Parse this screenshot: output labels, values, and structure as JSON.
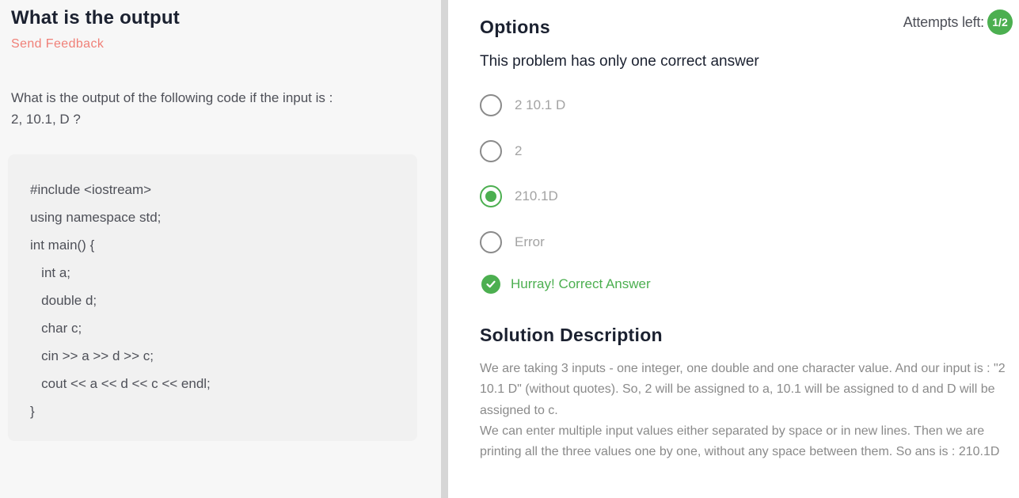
{
  "question": {
    "title": "What is the output",
    "feedback_label": "Send Feedback",
    "text_line1": "What is the output of the following code if the input is :",
    "text_line2": "2, 10.1, D ?",
    "code_lines": [
      "#include <iostream>",
      "using namespace std;",
      "int main() {",
      "   int a;",
      "   double d;",
      "   char c;",
      "   cin >> a >> d >> c;",
      "   cout << a << d << c << endl;",
      "}"
    ]
  },
  "options_panel": {
    "title": "Options",
    "attempts_label": "Attempts left:",
    "attempts_value": "1/2",
    "hint": "This problem has only one correct answer",
    "options": [
      {
        "label": "2 10.1 D",
        "selected": false
      },
      {
        "label": "2",
        "selected": false
      },
      {
        "label": "210.1D",
        "selected": true
      },
      {
        "label": "Error",
        "selected": false
      }
    ],
    "result_text": "Hurray! Correct Answer",
    "accent_color": "#4caf50"
  },
  "solution": {
    "title": "Solution Description",
    "lines": [
      "We are taking 3 inputs - one integer, one double and one character value. And our input is : \"2 10.1 D\" (without quotes). So, 2 will be assigned to a, 10.1 will be assigned to d and D will be assigned to c.",
      "We can enter multiple input values either separated by space or in new lines. Then we are printing all the three values one by one, without any space between them. So ans is : 210.1D"
    ]
  }
}
